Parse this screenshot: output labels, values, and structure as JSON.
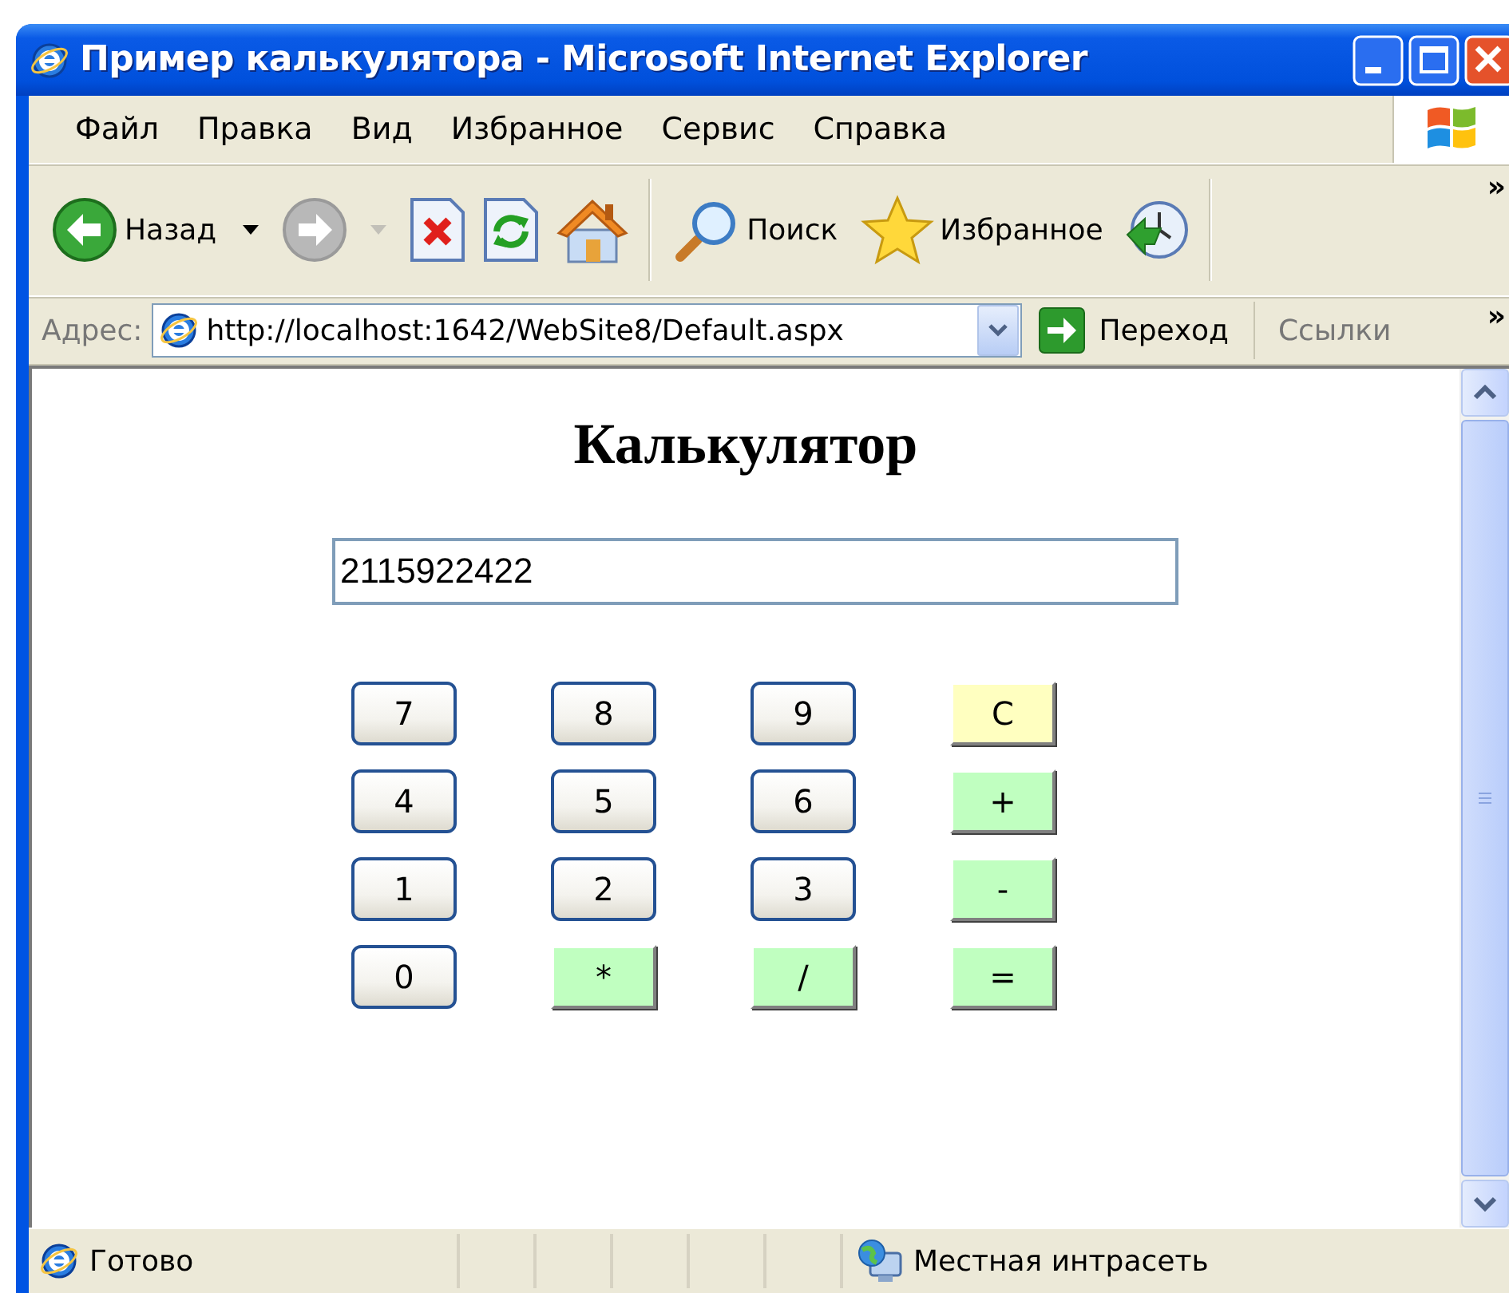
{
  "window": {
    "title": "Пример калькулятора - Microsoft Internet Explorer"
  },
  "menu": [
    {
      "label": "Файл"
    },
    {
      "label": "Правка"
    },
    {
      "label": "Вид"
    },
    {
      "label": "Избранное"
    },
    {
      "label": "Сервис"
    },
    {
      "label": "Справка"
    }
  ],
  "toolbar": {
    "back": "Назад",
    "forward_disabled": true,
    "search": "Поиск",
    "favorites": "Избранное",
    "more": "»"
  },
  "address_bar": {
    "label": "Адрес:",
    "url": "http://localhost:1642/WebSite8/Default.aspx",
    "go": "Переход",
    "links": "Ссылки",
    "more": "»"
  },
  "page": {
    "heading": "Калькулятор",
    "display": "2115922422",
    "keys": [
      {
        "label": "7",
        "kind": "digit"
      },
      {
        "label": "8",
        "kind": "digit"
      },
      {
        "label": "9",
        "kind": "digit"
      },
      {
        "label": "C",
        "kind": "clear"
      },
      {
        "label": "4",
        "kind": "digit"
      },
      {
        "label": "5",
        "kind": "digit"
      },
      {
        "label": "6",
        "kind": "digit"
      },
      {
        "label": "+",
        "kind": "operator"
      },
      {
        "label": "1",
        "kind": "digit"
      },
      {
        "label": "2",
        "kind": "digit"
      },
      {
        "label": "3",
        "kind": "digit"
      },
      {
        "label": "-",
        "kind": "operator"
      },
      {
        "label": "0",
        "kind": "digit"
      },
      {
        "label": "*",
        "kind": "operator"
      },
      {
        "label": "/",
        "kind": "operator"
      },
      {
        "label": "=",
        "kind": "operator"
      }
    ]
  },
  "status_bar": {
    "text": "Готово",
    "zone": "Местная интрасеть"
  }
}
